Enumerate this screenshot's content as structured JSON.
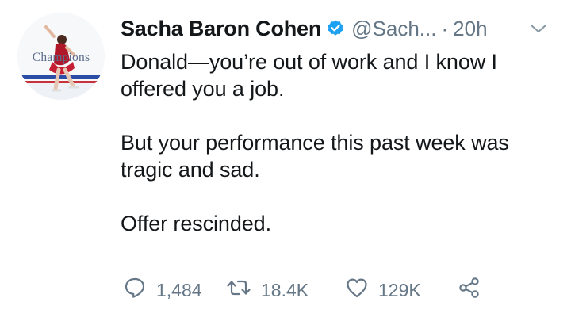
{
  "tweet": {
    "author_name": "Sacha Baron Cohen",
    "handle": "@Sach...",
    "separator": "·",
    "time": "20h",
    "verified": true,
    "paragraphs": [
      "Donald—you’re out of work and I know I offered you a job.",
      "But your performance this past week was tragic and sad.",
      "Offer rescinded."
    ],
    "counts": {
      "replies": "1,484",
      "retweets": "18.4K",
      "likes": "129K"
    }
  },
  "avatar": {
    "caption": "Champions"
  },
  "icons": {
    "verified": "verified-badge-icon",
    "menu": "chevron-down-icon",
    "reply": "reply-icon",
    "retweet": "retweet-icon",
    "like": "heart-icon",
    "share": "share-icon"
  },
  "colors": {
    "text": "#14171a",
    "muted": "#657786",
    "verified_blue": "#1da1f2",
    "dress_red": "#b0182a"
  }
}
